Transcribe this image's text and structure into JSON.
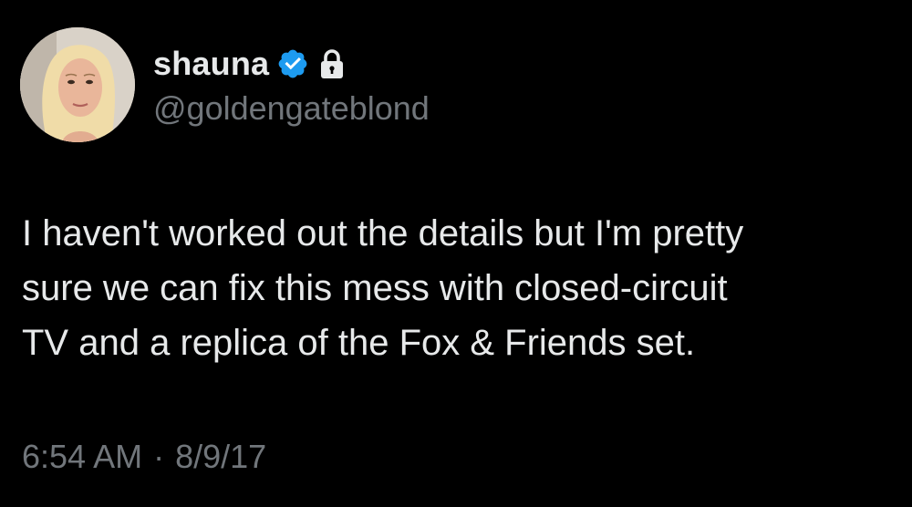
{
  "user": {
    "display_name": "shauna",
    "handle": "@goldengateblond",
    "verified": true,
    "protected": true,
    "avatar_icon": "profile-photo"
  },
  "tweet": {
    "lines": [
      "I haven't worked out the details but I'm pretty",
      "sure we can fix this mess with closed-circuit",
      "TV and a replica of the Fox & Friends set."
    ],
    "time": "6:54 AM",
    "separator": "·",
    "date": "8/9/17"
  },
  "colors": {
    "background": "#000000",
    "text_primary": "#e7e9ea",
    "text_secondary": "#71767b",
    "verified_blue": "#1d9bf0"
  }
}
